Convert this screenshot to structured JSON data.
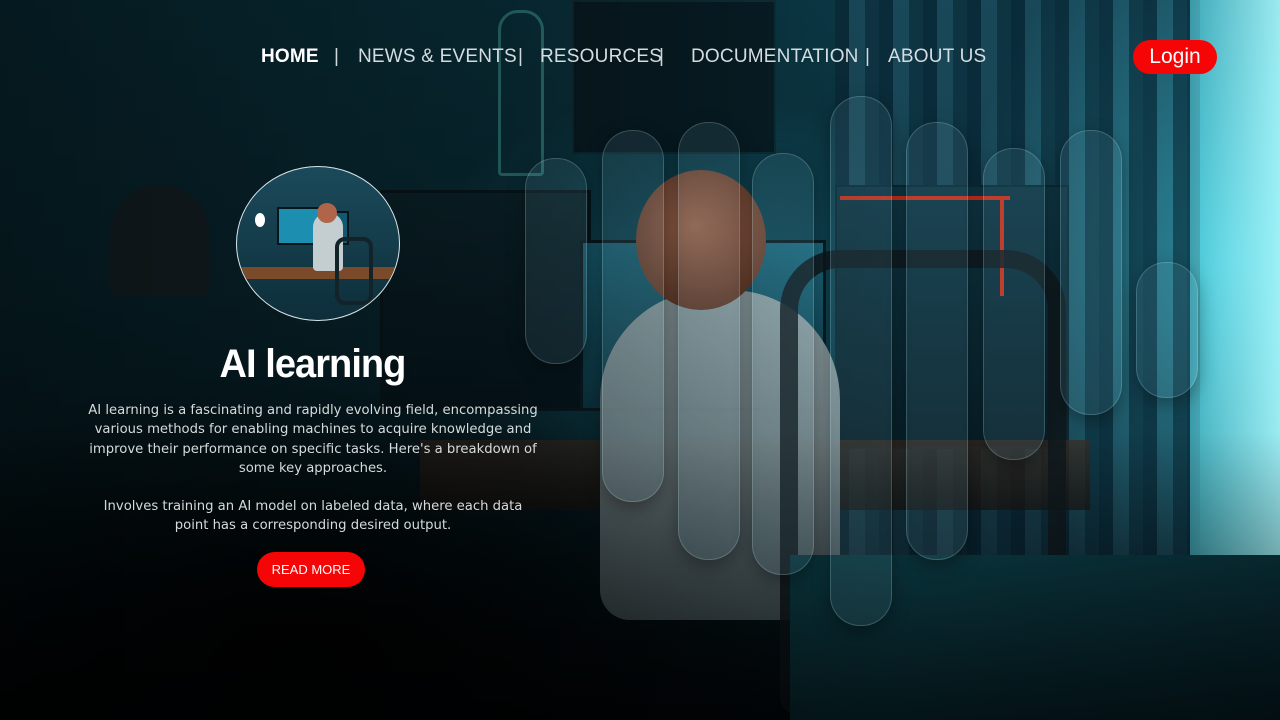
{
  "nav": {
    "items": [
      {
        "label": "HOME",
        "active": true
      },
      {
        "label": "NEWS & EVENTS",
        "active": false
      },
      {
        "label": "RESOURCES",
        "active": false
      },
      {
        "label": "DOCUMENTATION",
        "active": false
      },
      {
        "label": "ABOUT US",
        "active": false
      }
    ],
    "separator": "|",
    "login_label": "Login"
  },
  "hero": {
    "title": "AI learning",
    "paragraph1": "AI learning is a fascinating and rapidly evolving field, encompassing various methods for enabling machines to acquire knowledge and improve their performance on specific tasks. Here's a breakdown of some key approaches.",
    "paragraph2": "Involves training an AI model on labeled data, where each data point has a corresponding desired output.",
    "button_label": "READ MORE"
  },
  "colors": {
    "accent": "#f50505",
    "text_light": "#ffffff",
    "background": "#0a2f3a"
  }
}
